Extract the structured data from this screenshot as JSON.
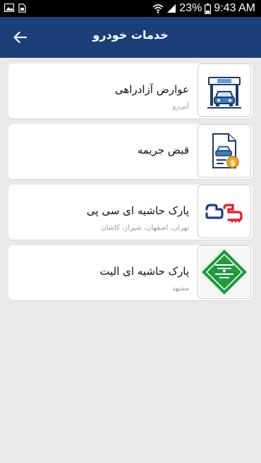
{
  "status_bar": {
    "battery": "23%",
    "time": "9:43 AM",
    "left_icons": [
      "image-icon",
      "sim-icon"
    ],
    "right_icons": [
      "wifi-icon",
      "signal-icon",
      "battery-icon"
    ]
  },
  "header": {
    "title": "خدمات خودرو",
    "back_icon": "arrow-left-icon",
    "color": "#1c3f7a"
  },
  "services": [
    {
      "title": "عوارض آزادراهی",
      "subtitle": "آنی‌رو",
      "icon": "toll-gate-car-icon"
    },
    {
      "title": "قبض جریمه",
      "subtitle": "",
      "icon": "fine-bill-icon"
    },
    {
      "title": "پارک حاشیه ای سی پی",
      "subtitle": "تهران، اصفهان، شیراز، کاشان",
      "icon": "cp-logo"
    },
    {
      "title": "پارک حاشیه ای الیت",
      "subtitle": "مشهد",
      "icon": "elite-logo"
    }
  ]
}
